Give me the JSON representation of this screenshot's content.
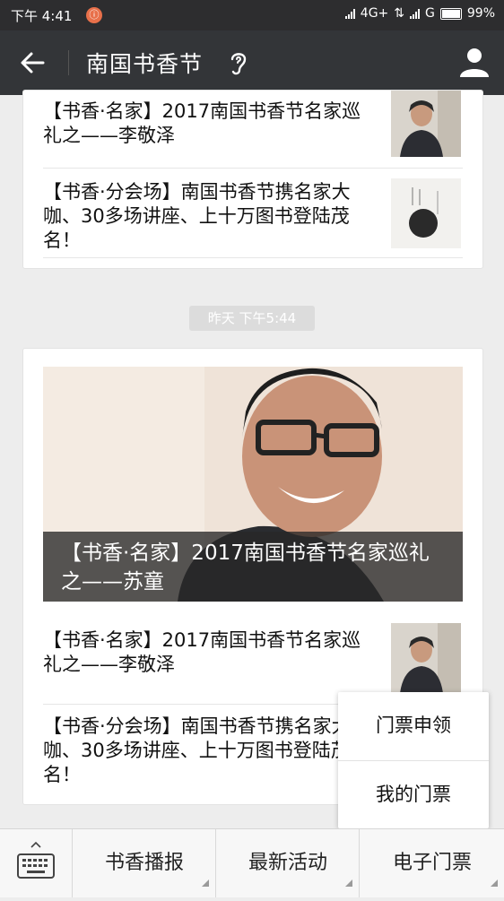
{
  "status_bar": {
    "time": "下午 4:41",
    "notification_badge": "ⓘ",
    "network_1": "4G+",
    "network_2": "G",
    "battery": "99%"
  },
  "nav": {
    "title": "南国书香节",
    "back_icon": "back-arrow-icon",
    "profile_icon": "user-icon"
  },
  "top_card": {
    "items": [
      {
        "title": "【书香·名家】2017南国书香节名家巡礼之——李敬泽"
      },
      {
        "title": "【书香·分会场】南国书香节携名家大咖、30多场讲座、上十万图书登陆茂名！"
      }
    ]
  },
  "timestamp": "昨天 下午5:44",
  "main_card": {
    "hero_caption": "【书香·名家】2017南国书香节名家巡礼之——苏童",
    "items": [
      {
        "title": "【书香·名家】2017南国书香节名家巡礼之——李敬泽"
      },
      {
        "title": "【书香·分会场】南国书香节携名家大咖、30多场讲座、上十万图书登陆茂名！"
      }
    ]
  },
  "popup_menu": {
    "items": [
      "门票申领",
      "我的门票"
    ]
  },
  "tab_bar": {
    "keyboard_icon": "keyboard-icon",
    "tabs": [
      "书香播报",
      "最新活动",
      "电子门票"
    ]
  }
}
